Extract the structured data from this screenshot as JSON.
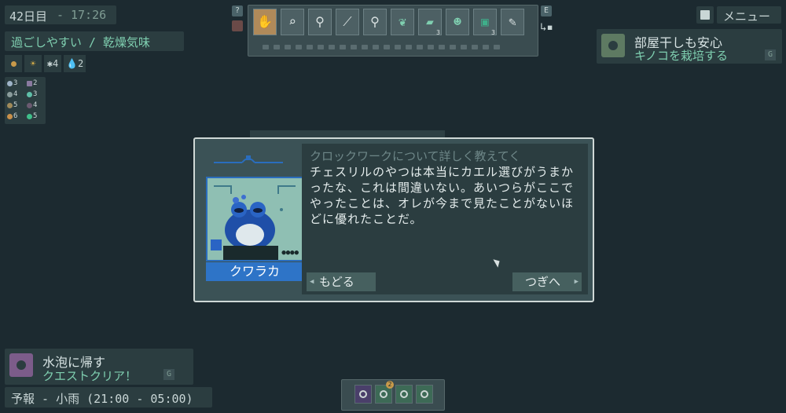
{
  "hud": {
    "day": "42日目",
    "sep": "-",
    "time": "17:26",
    "weather": "過ごしやすい / 乾燥気味",
    "stats": [
      {
        "icon": "coin-icon",
        "value": ""
      },
      {
        "icon": "sun-icon",
        "value": ""
      },
      {
        "icon": "sparkle-icon",
        "value": "4"
      },
      {
        "icon": "water-drop-icon",
        "value": "2"
      }
    ],
    "plants": [
      {
        "value": "3"
      },
      {
        "value": "2"
      },
      {
        "value": "4"
      },
      {
        "value": "3"
      },
      {
        "value": "5"
      },
      {
        "value": "4"
      },
      {
        "value": "6"
      },
      {
        "value": "5"
      }
    ]
  },
  "toolbar": {
    "help_key": "?",
    "swap_key": "E",
    "tools": [
      {
        "name": "glove-tool",
        "glyph": "✋",
        "count": ""
      },
      {
        "name": "magnifier-tool",
        "glyph": "🔍",
        "count": ""
      },
      {
        "name": "trowel-tool",
        "glyph": "⚒",
        "count": ""
      },
      {
        "name": "shovel-tool",
        "glyph": "⛏",
        "count": ""
      },
      {
        "name": "spray-tool",
        "glyph": "✦",
        "count": ""
      },
      {
        "name": "leaf-tool",
        "glyph": "❦",
        "count": ""
      },
      {
        "name": "eraser-tool",
        "glyph": "▰",
        "count": "3"
      },
      {
        "name": "frog-item",
        "glyph": "☻",
        "count": ""
      },
      {
        "name": "tank-item",
        "glyph": "▣",
        "count": "3"
      },
      {
        "name": "knife-tool",
        "glyph": "✎",
        "count": ""
      }
    ]
  },
  "menu": {
    "label": "メニュー"
  },
  "quest_top": {
    "title": "部屋干しも安心",
    "subtitle": "キノコを栽培する",
    "key": "G"
  },
  "dialog": {
    "prev_line": "クロックワークについて詳しく教えてく",
    "text": "チェスリルのやつは本当にカエル選びがうまかったな、これは間違いない。あいつらがここでやったことは、オレが今まで見たことがないほどに優れたことだ。",
    "speaker": "クワラカ",
    "back_label": "もどる",
    "next_label": "つぎへ",
    "portrait_counter": "●●●●"
  },
  "quest_bottom": {
    "title": "水泡に帰す",
    "subtitle": "クエストクリア！",
    "key": "G"
  },
  "forecast": {
    "text": "予報 - 小雨 (21:00 - 05:00)"
  },
  "hotbar": {
    "badge": "2"
  }
}
